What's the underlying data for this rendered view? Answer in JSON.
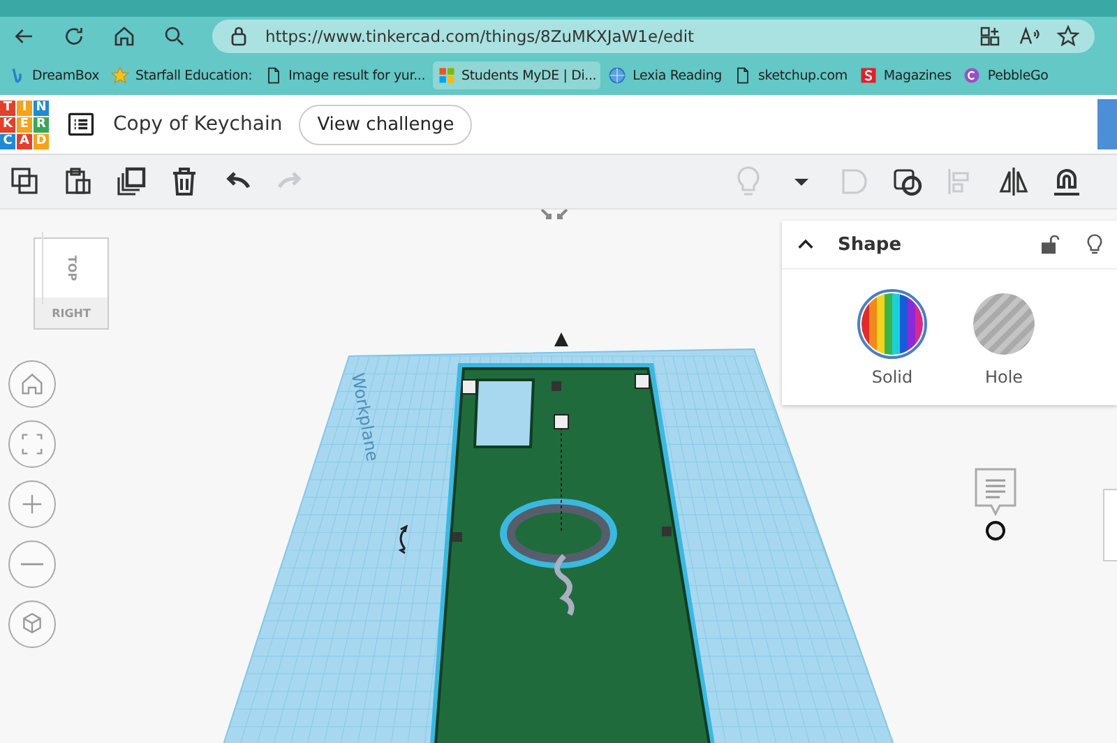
{
  "browser": {
    "url": "https://www.tinkercad.com/things/8ZuMKXJaW1e/edit",
    "bookmarks": [
      {
        "label": "DreamBox",
        "kind": "app"
      },
      {
        "label": "Starfall Education:",
        "kind": "star"
      },
      {
        "label": "Image result for yur...",
        "kind": "page"
      },
      {
        "label": "Students MyDE | Di...",
        "kind": "ms"
      },
      {
        "label": "Lexia Reading",
        "kind": "globe"
      },
      {
        "label": "sketchup.com",
        "kind": "page"
      },
      {
        "label": "Magazines",
        "kind": "s"
      },
      {
        "label": "PebbleGo",
        "kind": "c"
      }
    ]
  },
  "app": {
    "logo": [
      "T",
      "I",
      "N",
      "K",
      "E",
      "R",
      "C",
      "A",
      "D"
    ],
    "title": "Copy of Keychain",
    "challenge_button": "View challenge"
  },
  "view_cube": {
    "top": "TOP",
    "side": "RIGHT"
  },
  "workplane": {
    "label": "Workplane"
  },
  "shape_panel": {
    "title": "Shape",
    "options": [
      {
        "label": "Solid",
        "kind": "solid",
        "selected": true
      },
      {
        "label": "Hole",
        "kind": "hole",
        "selected": false
      }
    ]
  }
}
